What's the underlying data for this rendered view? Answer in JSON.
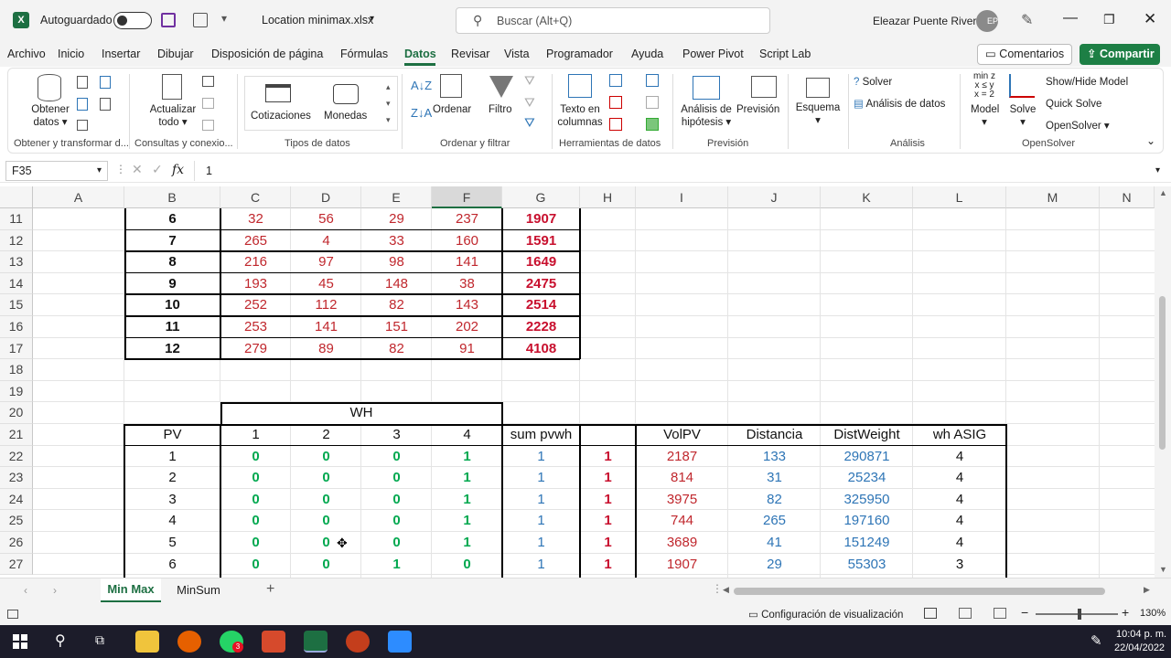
{
  "titlebar": {
    "autosave_label": "Autoguardado",
    "filename": "Location minimax.xlsx",
    "search_placeholder": "Buscar (Alt+Q)",
    "user_name": "Eleazar Puente Rivera",
    "user_initials": "EP"
  },
  "menu": [
    "Archivo",
    "Inicio",
    "Insertar",
    "Dibujar",
    "Disposición de página",
    "Fórmulas",
    "Datos",
    "Revisar",
    "Vista",
    "Programador",
    "Ayuda",
    "Power Pivot",
    "Script Lab"
  ],
  "active_menu": "Datos",
  "comments_label": "Comentarios",
  "share_label": "Compartir",
  "ribbon": {
    "obtener": "Obtener",
    "datos": "datos",
    "actualizar": "Actualizar",
    "todo": "todo",
    "cotizaciones": "Cotizaciones",
    "monedas": "Monedas",
    "ordenar": "Ordenar",
    "filtro": "Filtro",
    "texto_en": "Texto en",
    "columnas": "columnas",
    "analisis_de": "Análisis de",
    "hipotesis": "hipótesis",
    "prevision": "Previsión",
    "esquema": "Esquema",
    "solver": "Solver",
    "analisis_datos": "Análisis de datos",
    "minz": "min z",
    "xsy": "x ≤ y",
    "x2": "x = 2",
    "model": "Model",
    "solve": "Solve",
    "show_hide": "Show/Hide Model",
    "quick_solve": "Quick Solve",
    "opensolver": "OpenSolver",
    "groups": [
      "Obtener y transformar d...",
      "Consultas y conexio...",
      "Tipos de datos",
      "Ordenar y filtrar",
      "Herramientas de datos",
      "Previsión",
      "Análisis",
      "OpenSolver"
    ]
  },
  "formula_bar": {
    "name_box": "F35",
    "fx": "fx",
    "value": "1"
  },
  "columns": [
    "A",
    "B",
    "C",
    "D",
    "E",
    "F",
    "G",
    "H",
    "I",
    "J",
    "K",
    "L",
    "M",
    "N"
  ],
  "rows": [
    "11",
    "12",
    "13",
    "14",
    "15",
    "16",
    "17",
    "18",
    "19",
    "20",
    "21",
    "22",
    "23",
    "24",
    "25",
    "26",
    "27"
  ],
  "table_top": [
    [
      "6",
      "32",
      "56",
      "29",
      "237",
      "1907"
    ],
    [
      "7",
      "265",
      "4",
      "33",
      "160",
      "1591"
    ],
    [
      "8",
      "216",
      "97",
      "98",
      "141",
      "1649"
    ],
    [
      "9",
      "193",
      "45",
      "148",
      "38",
      "2475"
    ],
    [
      "10",
      "252",
      "112",
      "82",
      "143",
      "2514"
    ],
    [
      "11",
      "253",
      "141",
      "151",
      "202",
      "2228"
    ],
    [
      "12",
      "279",
      "89",
      "82",
      "91",
      "4108"
    ]
  ],
  "wh_header": "WH",
  "table_bottom_header": [
    "PV",
    "1",
    "2",
    "3",
    "4",
    "sum pvwh",
    "",
    "VolPV",
    "Distancia",
    "DistWeight",
    "wh ASIG"
  ],
  "table_bottom": [
    [
      "1",
      "0",
      "0",
      "0",
      "1",
      "1",
      "1",
      "2187",
      "133",
      "290871",
      "4"
    ],
    [
      "2",
      "0",
      "0",
      "0",
      "1",
      "1",
      "1",
      "814",
      "31",
      "25234",
      "4"
    ],
    [
      "3",
      "0",
      "0",
      "0",
      "1",
      "1",
      "1",
      "3975",
      "82",
      "325950",
      "4"
    ],
    [
      "4",
      "0",
      "0",
      "0",
      "1",
      "1",
      "1",
      "744",
      "265",
      "197160",
      "4"
    ],
    [
      "5",
      "0",
      "0",
      "0",
      "1",
      "1",
      "1",
      "3689",
      "41",
      "151249",
      "4"
    ],
    [
      "6",
      "0",
      "0",
      "1",
      "0",
      "1",
      "1",
      "1907",
      "29",
      "55303",
      "3"
    ]
  ],
  "sheets": [
    "Min Max",
    "MinSum"
  ],
  "active_sheet": "Min Max",
  "status": {
    "display_settings": "Configuración de visualización",
    "zoom": "130%"
  },
  "taskbar": {
    "time": "10:04 p. m.",
    "date": "22/04/2022",
    "badge": "3"
  }
}
